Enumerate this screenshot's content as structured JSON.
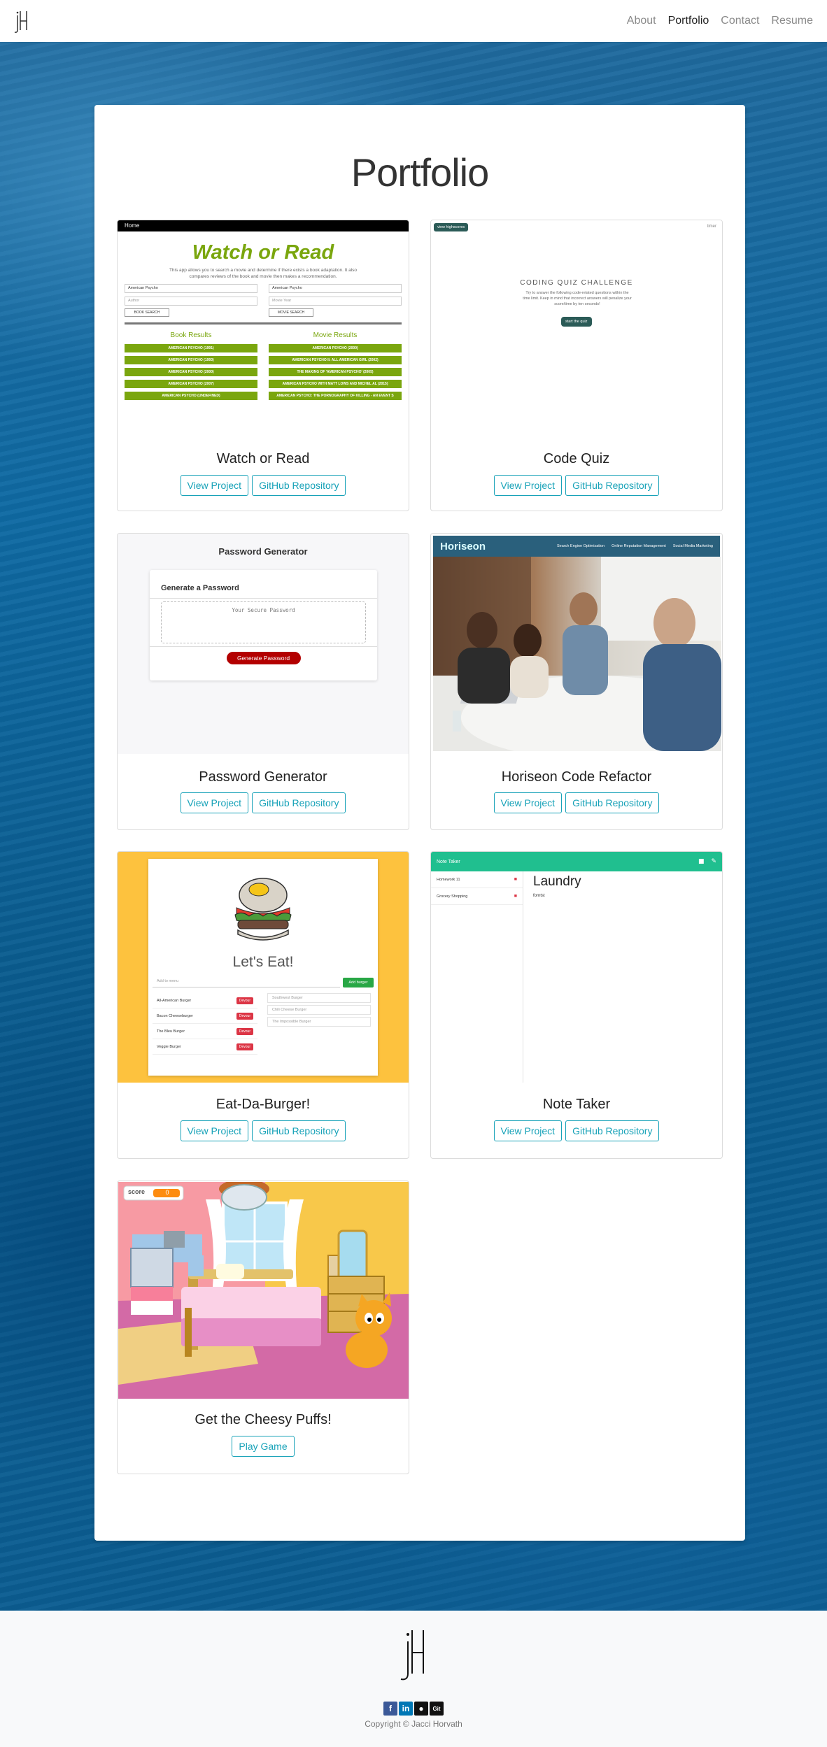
{
  "nav": {
    "brand": "jH",
    "links": [
      {
        "label": "About",
        "active": false
      },
      {
        "label": "Portfolio",
        "active": true
      },
      {
        "label": "Contact",
        "active": false
      },
      {
        "label": "Resume",
        "active": false
      }
    ]
  },
  "main": {
    "title": "Portfolio",
    "projects": [
      {
        "title": "Watch or Read",
        "buttons": [
          "View Project",
          "GitHub Repository"
        ],
        "preview": {
          "topbar": "Home",
          "heading": "Watch or Read",
          "intro": "This app allows you to search a movie and determine if there exists a book adaptation. It also compares reviews of the book and movie then makes a recommendation.",
          "book_input": "American Psycho",
          "book_author": "Author",
          "book_button": "BOOK SEARCH",
          "movie_input": "American Psycho",
          "movie_year": "Movie Year",
          "movie_button": "MOVIE SEARCH",
          "book_results_label": "Book Results",
          "movie_results_label": "Movie Results",
          "book_results": [
            "AMERICAN PSYCHO (1991)",
            "AMERICAN PSYCHO (1993)",
            "AMERICAN PSYCHO (2000)",
            "AMERICAN PSYCHO (2007)",
            "AMERICAN PSYCHO (UNDEFINED)"
          ],
          "movie_results": [
            "AMERICAN PSYCHO (2000)",
            "AMERICAN PSYCHO II: ALL AMERICAN GIRL (2002)",
            "THE MAKING OF 'AMERICAN PSYCHO' (2005)",
            "AMERICAN PSYCHO WITH MATT LOWS AND MICHEL AL (2015)",
            "AMERICAN PSYCHO: THE PORNOGRAPHY OF KILLING - AN EVENT S"
          ]
        }
      },
      {
        "title": "Code Quiz",
        "buttons": [
          "View Project",
          "GitHub Repository"
        ],
        "preview": {
          "highscores": "view highscores",
          "timer": "timer",
          "heading": "CODING QUIZ CHALLENGE",
          "text": "Try to answer the following code-related questions within the time limit. Keep in mind that incorrect answers will penalize your score/time by ten seconds!",
          "start": "start the quiz"
        }
      },
      {
        "title": "Password Generator",
        "buttons": [
          "View Project",
          "GitHub Repository"
        ],
        "preview": {
          "heading": "Password Generator",
          "card_title": "Generate a Password",
          "placeholder": "Your Secure Password",
          "button": "Generate Password"
        }
      },
      {
        "title": "Horiseon Code Refactor",
        "buttons": [
          "View Project",
          "GitHub Repository"
        ],
        "preview": {
          "brand": "Horiseon",
          "links": [
            "Search Engine Optimization",
            "Online Reputation Management",
            "Social Media Marketing"
          ]
        }
      },
      {
        "title": "Eat-Da-Burger!",
        "buttons": [
          "View Project",
          "GitHub Repository"
        ],
        "preview": {
          "heading": "Let's Eat!",
          "input_placeholder": "Add to menu",
          "add_button": "Add burger",
          "menu": [
            "All-American Burger",
            "Bacon Cheeseburger",
            "The Bleu Burger",
            "Veggie Burger"
          ],
          "devour": "Devour",
          "devoured": [
            "Southwest Burger",
            "Chili Cheese Burger",
            "The Impossible Burger"
          ]
        }
      },
      {
        "title": "Note Taker",
        "buttons": [
          "View Project",
          "GitHub Repository"
        ],
        "preview": {
          "app_title": "Note Taker",
          "notes": [
            "Homework 11",
            "Grocery Shopping"
          ],
          "note_title": "Laundry",
          "note_body": "forntst"
        }
      },
      {
        "title": "Get the Cheesy Puffs!",
        "buttons": [
          "Play Game"
        ],
        "preview": {
          "score_label": "score",
          "score_value": "0"
        }
      }
    ]
  },
  "footer": {
    "logo": "jH",
    "social": [
      {
        "icon": "facebook-icon",
        "glyph": "f",
        "color": "#3b5998"
      },
      {
        "icon": "linkedin-icon",
        "glyph": "in",
        "color": "#0077b5"
      },
      {
        "icon": "github-icon",
        "glyph": "●",
        "color": "#111111"
      },
      {
        "icon": "git-icon",
        "glyph": "Git",
        "color": "#111111"
      }
    ],
    "copyright": "Copyright © Jacci Horvath"
  },
  "colors": {
    "accent": "#17a2b8",
    "watch_green": "#7aa60e",
    "note_green": "#20bf8f",
    "horiseon_bar": "#2a607c",
    "burger_bg": "#fdc23e",
    "danger": "#dc3545"
  }
}
